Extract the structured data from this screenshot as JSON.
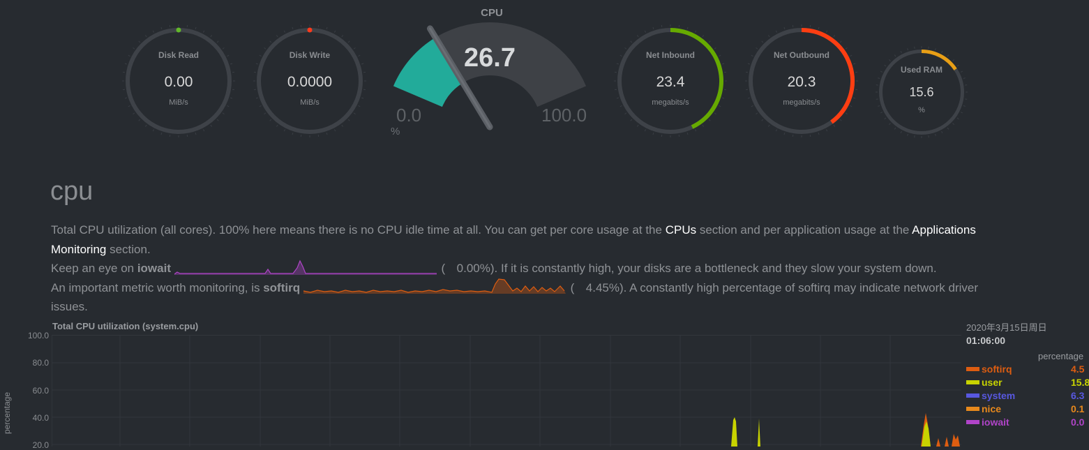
{
  "gauges": {
    "disk_read": {
      "label": "Disk Read",
      "value": "0.00",
      "unit": "MiB/s",
      "fill": 0.0,
      "color": "#62b82a",
      "marker": true
    },
    "disk_write": {
      "label": "Disk Write",
      "value": "0.0000",
      "unit": "MiB/s",
      "fill": 0.0,
      "color": "#ff3a1c",
      "marker": true
    },
    "net_inbound": {
      "label": "Net Inbound",
      "value": "23.4",
      "unit": "megabits/s",
      "fill": 0.43,
      "color": "#66aa00"
    },
    "net_outbound": {
      "label": "Net Outbound",
      "value": "20.3",
      "unit": "megabits/s",
      "fill": 0.4,
      "color": "#fd3e12"
    },
    "used_ram": {
      "label": "Used RAM",
      "value": "15.6",
      "unit": "%",
      "fill": 0.156,
      "color": "#e89f16"
    }
  },
  "cpu_gauge": {
    "title": "CPU",
    "value": "26.7",
    "min": "0.0",
    "max": "100.0",
    "unit": "%",
    "percent": 26.7,
    "color": "#22ab9a"
  },
  "section": {
    "title": "cpu"
  },
  "description": {
    "line1_a": "Total CPU utilization (all cores). 100% here means there is no CPU idle time at all. You can get per core usage at the ",
    "cpus_link": "CPUs",
    "line1_b": " section and per application usage at the ",
    "apps_link": "Applications",
    "line2_link": "Monitoring",
    "line2_b": " section.",
    "line3_a": "Keep an eye on ",
    "iowait": "iowait",
    "iowait_pct": "0.00%",
    "line3_b": "). If it is constantly high, your disks are a bottleneck and they slow your system down.",
    "line4_a": "An important metric worth monitoring, is ",
    "softirq": "softirq",
    "softirq_pct": "4.45%",
    "line4_b": "). A constantly high percentage of softirq may indicate network driver",
    "line5": "issues.",
    "open_paren": "("
  },
  "chart": {
    "title": "Total CPU utilization (system.cpu)",
    "ylabel": "percentage",
    "yticks": [
      "100.0",
      "80.0",
      "60.0",
      "40.0",
      "20.0"
    ],
    "date": "2020年3月15日周日",
    "time": "01:06:00",
    "units": "percentage",
    "legend": [
      {
        "name": "softirq",
        "value": "4.5",
        "color": "#dd5d11"
      },
      {
        "name": "user",
        "value": "15.8",
        "color": "#c8d300"
      },
      {
        "name": "system",
        "value": "6.3",
        "color": "#5858e0"
      },
      {
        "name": "nice",
        "value": "0.1",
        "color": "#e8891c"
      },
      {
        "name": "iowait",
        "value": "0.0",
        "color": "#b044c8"
      }
    ]
  },
  "chart_data": {
    "type": "area",
    "title": "Total CPU utilization (system.cpu)",
    "ylabel": "percentage",
    "ylim": [
      0,
      100
    ],
    "series": [
      {
        "name": "softirq",
        "current": 4.5
      },
      {
        "name": "user",
        "current": 15.8
      },
      {
        "name": "system",
        "current": 6.3
      },
      {
        "name": "nice",
        "current": 0.1
      },
      {
        "name": "iowait",
        "current": 0.0
      }
    ]
  }
}
